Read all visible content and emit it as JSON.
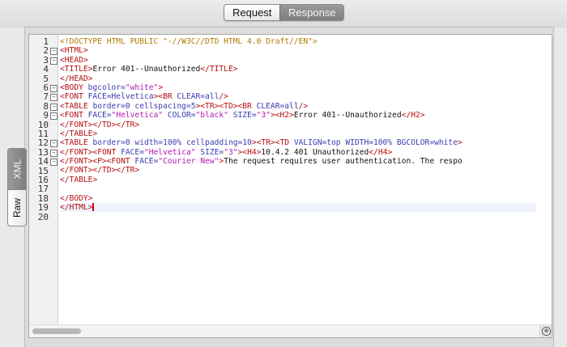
{
  "tabs": {
    "request": "Request",
    "response": "Response"
  },
  "side_tabs": {
    "xml": "XML",
    "raw": "Raw"
  },
  "editor": {
    "line_numbers": [
      "1",
      "2",
      "3",
      "4",
      "5",
      "6",
      "7",
      "8",
      "9",
      "10",
      "11",
      "12",
      "13",
      "14",
      "15",
      "16",
      "17",
      "18",
      "19",
      "20"
    ],
    "fold_lines": [
      2,
      3,
      6,
      7,
      8,
      9,
      12,
      13,
      14
    ],
    "lines": [
      [
        [
          "doc",
          "<!DOCTYPE HTML PUBLIC \"-//W3C//DTD HTML 4.0 Draft//EN\">"
        ]
      ],
      [
        [
          "tag",
          "<HTML>"
        ]
      ],
      [
        [
          "tag",
          "<HEAD>"
        ]
      ],
      [
        [
          "tag",
          "<TITLE>"
        ],
        [
          "txt",
          "Error 401--Unauthorized"
        ],
        [
          "tag",
          "</TITLE>"
        ]
      ],
      [
        [
          "tag",
          "</HEAD>"
        ]
      ],
      [
        [
          "tag",
          "<BODY "
        ],
        [
          "attr",
          "bgcolor="
        ],
        [
          "str",
          "\"white\""
        ],
        [
          "tag",
          ">"
        ]
      ],
      [
        [
          "tag",
          "<FONT "
        ],
        [
          "attr",
          "FACE=Helvetica"
        ],
        [
          "tag",
          "><BR "
        ],
        [
          "attr",
          "CLEAR=all"
        ],
        [
          "tag",
          "/>"
        ]
      ],
      [
        [
          "tag",
          "<TABLE "
        ],
        [
          "attr",
          "border=0 cellspacing=5"
        ],
        [
          "tag",
          "><TR><TD><BR "
        ],
        [
          "attr",
          "CLEAR=all"
        ],
        [
          "tag",
          "/>"
        ]
      ],
      [
        [
          "tag",
          "<FONT "
        ],
        [
          "attr",
          "FACE="
        ],
        [
          "str",
          "\"Helvetica\""
        ],
        [
          "attr",
          " COLOR="
        ],
        [
          "str",
          "\"black\""
        ],
        [
          "attr",
          " SIZE="
        ],
        [
          "str",
          "\"3\""
        ],
        [
          "tag",
          "><H2>"
        ],
        [
          "txt",
          "Error 401--Unauthorized"
        ],
        [
          "tag",
          "</H2>"
        ]
      ],
      [
        [
          "tag",
          "</FONT></TD></TR>"
        ]
      ],
      [
        [
          "tag",
          "</TABLE>"
        ]
      ],
      [
        [
          "tag",
          "<TABLE "
        ],
        [
          "attr",
          "border=0 width=100% cellpadding=10"
        ],
        [
          "tag",
          "><TR><TD "
        ],
        [
          "attr",
          "VALIGN=top WIDTH=100% BGCOLOR=white"
        ],
        [
          "tag",
          ">"
        ]
      ],
      [
        [
          "tag",
          "</FONT><FONT "
        ],
        [
          "attr",
          "FACE="
        ],
        [
          "str",
          "\"Helvetica\""
        ],
        [
          "attr",
          " SIZE="
        ],
        [
          "str",
          "\"3\""
        ],
        [
          "tag",
          "><H4>"
        ],
        [
          "txt",
          "10.4.2 401 Unauthorized"
        ],
        [
          "tag",
          "</H4>"
        ]
      ],
      [
        [
          "tag",
          "</FONT><P><FONT "
        ],
        [
          "attr",
          "FACE="
        ],
        [
          "str",
          "\"Courier New\""
        ],
        [
          "tag",
          ">"
        ],
        [
          "txt",
          "The request requires user authentication. The respo"
        ]
      ],
      [
        [
          "tag",
          "</FONT></TD></TR>"
        ]
      ],
      [
        [
          "tag",
          "</TABLE>"
        ]
      ],
      [],
      [
        [
          "tag",
          "</BODY>"
        ]
      ],
      [
        [
          "tag",
          "</HTML>"
        ]
      ],
      []
    ],
    "current_line": 19
  }
}
